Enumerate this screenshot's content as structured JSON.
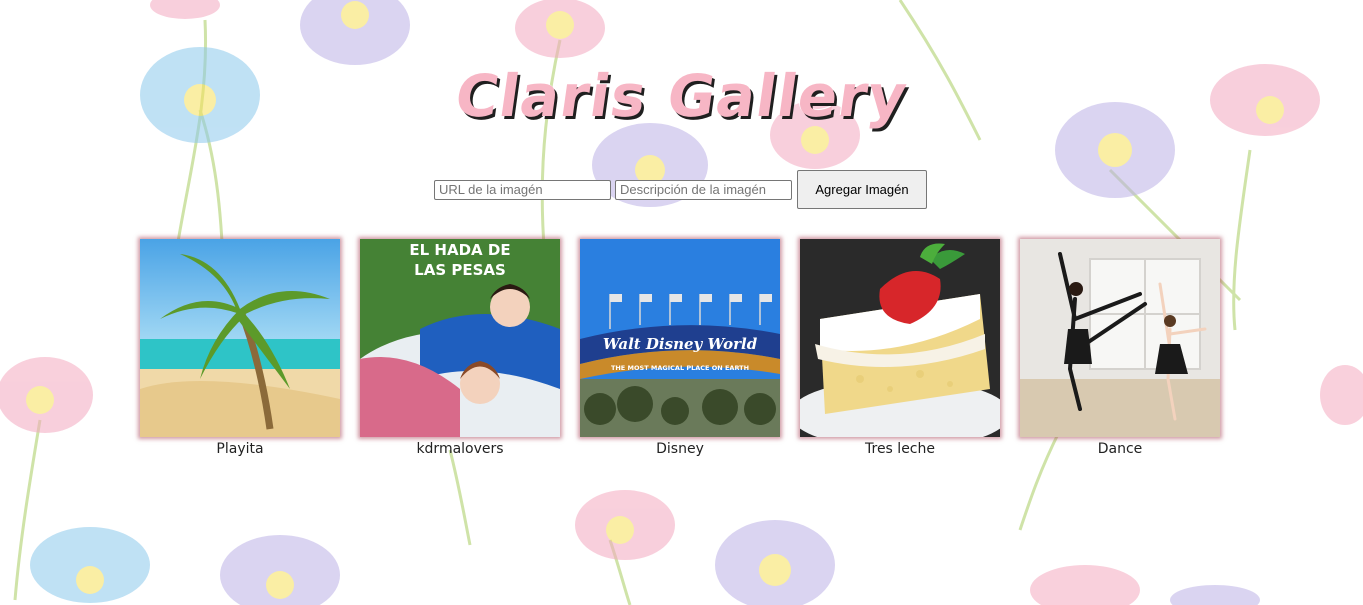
{
  "header": {
    "title": "Claris Gallery"
  },
  "form": {
    "url_placeholder": "URL de la imagén",
    "desc_placeholder": "Descripción de la imagén",
    "submit_label": "Agregar Imagén"
  },
  "gallery": {
    "items": [
      {
        "caption": "Playita",
        "icon": "beach-palm-image"
      },
      {
        "caption": "kdrmalovers",
        "icon": "kdrama-poster-image",
        "overlay": "EL HADA DE LAS PESAS"
      },
      {
        "caption": "Disney",
        "icon": "disney-gate-image",
        "overlay": "Walt Disney World",
        "overlay_sub": "THE MOST MAGICAL PLACE ON EARTH"
      },
      {
        "caption": "Tres leche",
        "icon": "cake-image"
      },
      {
        "caption": "Dance",
        "icon": "dancers-image"
      }
    ]
  },
  "colors": {
    "title_fill": "#f7b6c5",
    "frame_shadow": "#aa465a"
  }
}
